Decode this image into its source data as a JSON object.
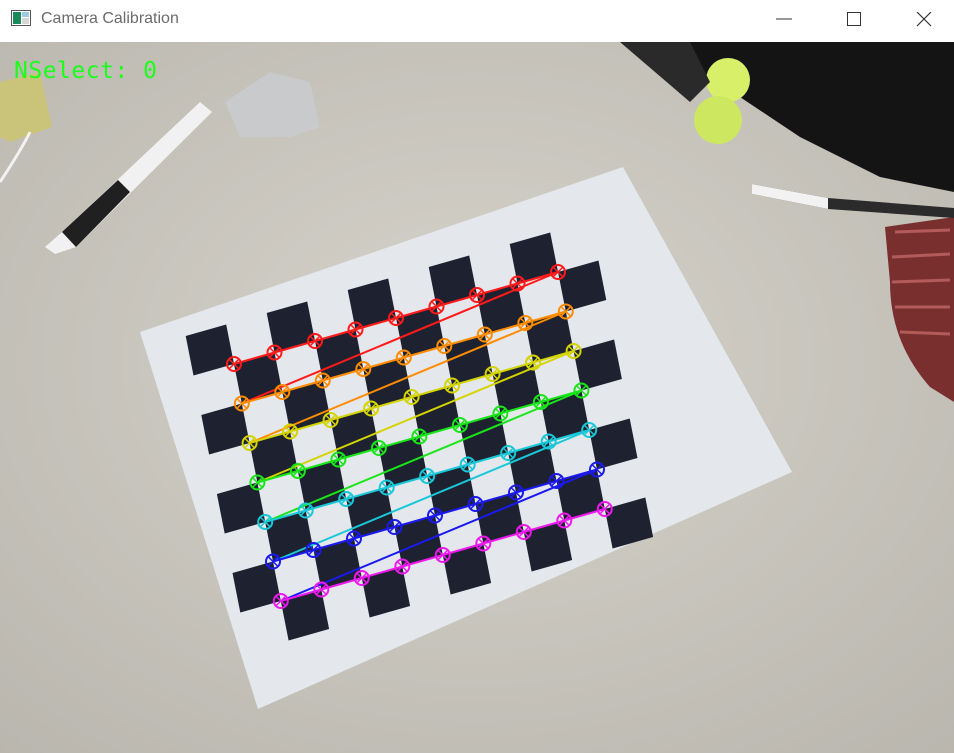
{
  "window": {
    "title": "Camera Calibration",
    "controls": [
      "minimize",
      "maximize",
      "close"
    ]
  },
  "overlay": {
    "nselect_text": "NSelect: 0",
    "text_color": "#19ff19"
  },
  "colors": {
    "title_text": "#6b6b6b",
    "desk": "#cfcbc2",
    "paper": "#e6e9ee",
    "checker": "#1e2230",
    "corner_rows": [
      "#ff1a1a",
      "#ff8c00",
      "#d4d400",
      "#19e619",
      "#19c8d8",
      "#1a1aee",
      "#ee19ee"
    ]
  },
  "icons": {
    "app": "opencv-window-icon",
    "minimize": "minimize-icon",
    "maximize": "maximize-icon",
    "close": "close-icon"
  }
}
